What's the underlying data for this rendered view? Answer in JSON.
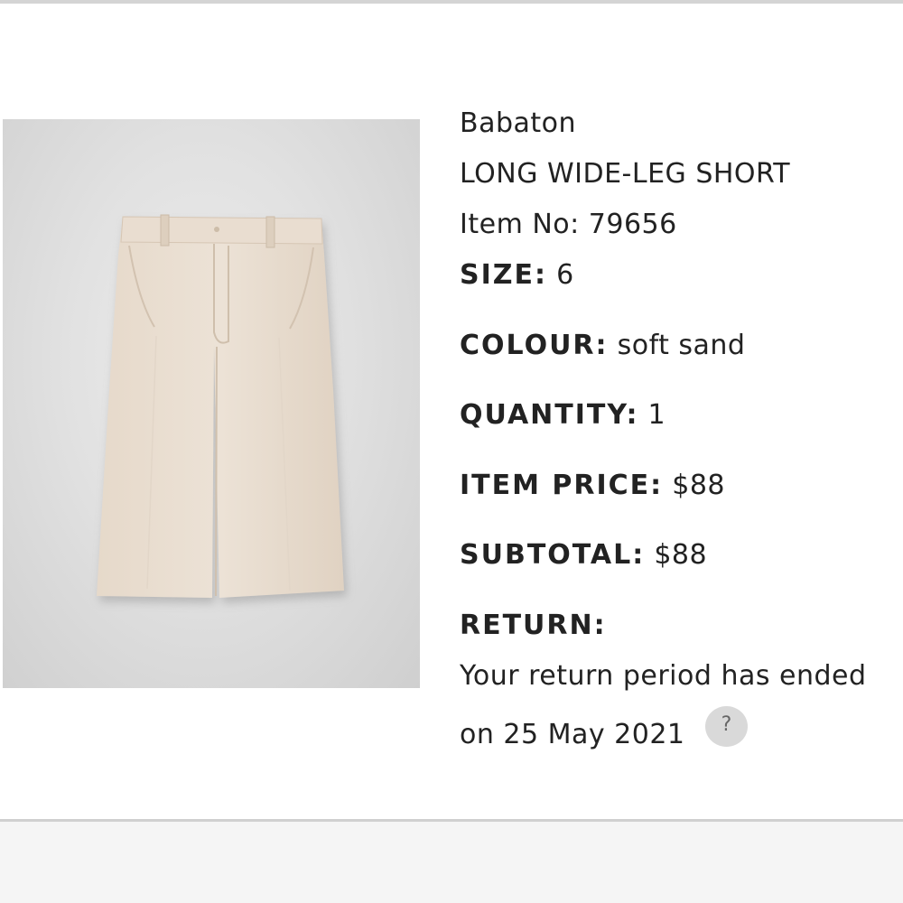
{
  "product": {
    "brand": "Babaton",
    "name": "LONG WIDE-LEG SHORT",
    "item_no": "Item No: 79656",
    "image_icon": "garment-photo",
    "garment_color": "#e8dccf"
  },
  "specs": {
    "size_label": "SIZE:",
    "size_value": "6",
    "colour_label": "COLOUR:",
    "colour_value": "soft sand",
    "quantity_label": "QUANTITY:",
    "quantity_value": "1",
    "item_price_label": "ITEM PRICE:",
    "item_price_value": "$88",
    "subtotal_label": "SUBTOTAL:",
    "subtotal_value": "$88"
  },
  "returns": {
    "label": "RETURN:",
    "message_line1": "Your return period has ended",
    "message_line2": "on 25 May 2021",
    "help_label": "?",
    "help_icon": "question-mark-icon"
  }
}
